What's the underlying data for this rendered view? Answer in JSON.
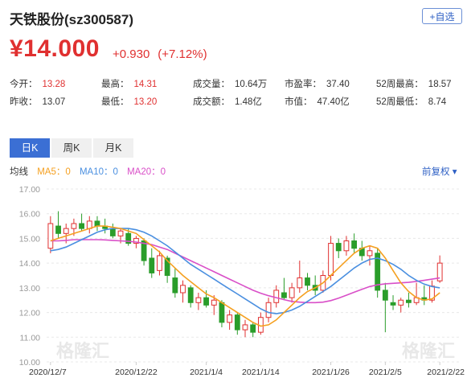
{
  "header": {
    "stock_title": "天铁股份(sz300587)",
    "add_button": "+自选"
  },
  "quote": {
    "price": "¥14.000",
    "change": "+0.930",
    "change_pct": "(+7.12%)"
  },
  "stats": {
    "open_label": "今开：",
    "open": "13.28",
    "high_label": "最高：",
    "high": "14.31",
    "volume_label": "成交量：",
    "volume": "10.64万",
    "pe_label": "市盈率：",
    "pe": "37.40",
    "w52_high_label": "52周最高：",
    "w52_high": "18.57",
    "prev_close_label": "昨收：",
    "prev_close": "13.07",
    "low_label": "最低：",
    "low": "13.20",
    "turnover_label": "成交额：",
    "turnover": "1.48亿",
    "mcap_label": "市值：",
    "mcap": "47.40亿",
    "w52_low_label": "52周最低：",
    "w52_low": "8.74"
  },
  "tabs": [
    "日K",
    "周K",
    "月K"
  ],
  "ma_legend": {
    "label": "均线",
    "ma5": "MA5：0",
    "ma10": "MA10：0",
    "ma20": "MA20：0"
  },
  "adjust_dropdown": "前复权 ▾",
  "watermark": "格隆汇",
  "colors": {
    "up": "#e03030",
    "down": "#2a9d2a",
    "ma5": "#f5a020",
    "ma10": "#4a8fe0",
    "ma20": "#d94fc8",
    "accent": "#3b6fd4"
  },
  "chart_data": {
    "type": "candlestick",
    "y_ticks": [
      "17.00",
      "16.00",
      "15.00",
      "14.00",
      "13.00",
      "12.00",
      "11.00",
      "10.00"
    ],
    "ylim": [
      10,
      17
    ],
    "x_tick_labels": [
      "2020/12/7",
      "2020/12/22",
      "2021/1/4",
      "2021/1/14",
      "2021/1/26",
      "2021/2/5",
      "2021/2/22"
    ],
    "x_tick_index": [
      0,
      11,
      20,
      27,
      36,
      43,
      50
    ],
    "candles": [
      {
        "o": 14.6,
        "h": 15.9,
        "l": 14.4,
        "c": 15.6
      },
      {
        "o": 15.5,
        "h": 16.1,
        "l": 15.0,
        "c": 15.2
      },
      {
        "o": 15.2,
        "h": 15.6,
        "l": 14.8,
        "c": 15.4
      },
      {
        "o": 15.4,
        "h": 15.8,
        "l": 15.1,
        "c": 15.6
      },
      {
        "o": 15.6,
        "h": 16.0,
        "l": 15.3,
        "c": 15.4
      },
      {
        "o": 15.4,
        "h": 15.9,
        "l": 15.2,
        "c": 15.7
      },
      {
        "o": 15.7,
        "h": 15.9,
        "l": 15.3,
        "c": 15.5
      },
      {
        "o": 15.5,
        "h": 15.8,
        "l": 15.2,
        "c": 15.4
      },
      {
        "o": 15.4,
        "h": 15.6,
        "l": 15.0,
        "c": 15.1
      },
      {
        "o": 15.1,
        "h": 15.4,
        "l": 14.8,
        "c": 15.3
      },
      {
        "o": 15.2,
        "h": 15.4,
        "l": 14.7,
        "c": 14.8
      },
      {
        "o": 14.8,
        "h": 15.1,
        "l": 14.6,
        "c": 15.0
      },
      {
        "o": 14.9,
        "h": 15.0,
        "l": 13.9,
        "c": 14.1
      },
      {
        "o": 14.2,
        "h": 14.6,
        "l": 13.4,
        "c": 13.6
      },
      {
        "o": 13.7,
        "h": 14.5,
        "l": 13.5,
        "c": 14.3
      },
      {
        "o": 14.2,
        "h": 14.3,
        "l": 13.2,
        "c": 13.5
      },
      {
        "o": 13.4,
        "h": 13.8,
        "l": 12.6,
        "c": 12.8
      },
      {
        "o": 12.8,
        "h": 13.3,
        "l": 12.4,
        "c": 13.1
      },
      {
        "o": 13.0,
        "h": 13.1,
        "l": 12.2,
        "c": 12.4
      },
      {
        "o": 12.4,
        "h": 12.8,
        "l": 12.1,
        "c": 12.6
      },
      {
        "o": 12.6,
        "h": 12.9,
        "l": 12.2,
        "c": 12.3
      },
      {
        "o": 12.3,
        "h": 12.7,
        "l": 11.9,
        "c": 12.5
      },
      {
        "o": 12.4,
        "h": 12.5,
        "l": 11.4,
        "c": 11.6
      },
      {
        "o": 11.6,
        "h": 12.1,
        "l": 11.3,
        "c": 11.9
      },
      {
        "o": 11.9,
        "h": 12.0,
        "l": 11.1,
        "c": 11.3
      },
      {
        "o": 11.3,
        "h": 11.7,
        "l": 11.0,
        "c": 11.5
      },
      {
        "o": 11.5,
        "h": 11.6,
        "l": 11.0,
        "c": 11.2
      },
      {
        "o": 11.2,
        "h": 12.0,
        "l": 11.1,
        "c": 11.8
      },
      {
        "o": 11.8,
        "h": 12.6,
        "l": 11.6,
        "c": 12.4
      },
      {
        "o": 12.4,
        "h": 13.1,
        "l": 12.2,
        "c": 12.9
      },
      {
        "o": 12.8,
        "h": 13.4,
        "l": 12.5,
        "c": 12.6
      },
      {
        "o": 12.6,
        "h": 13.2,
        "l": 12.4,
        "c": 13.0
      },
      {
        "o": 13.0,
        "h": 14.1,
        "l": 12.8,
        "c": 13.4
      },
      {
        "o": 13.4,
        "h": 13.6,
        "l": 12.9,
        "c": 13.1
      },
      {
        "o": 13.1,
        "h": 13.5,
        "l": 12.7,
        "c": 12.9
      },
      {
        "o": 12.9,
        "h": 13.7,
        "l": 12.8,
        "c": 13.5
      },
      {
        "o": 13.5,
        "h": 15.1,
        "l": 13.3,
        "c": 14.8
      },
      {
        "o": 14.8,
        "h": 15.0,
        "l": 14.2,
        "c": 14.5
      },
      {
        "o": 14.5,
        "h": 15.1,
        "l": 14.3,
        "c": 14.9
      },
      {
        "o": 14.9,
        "h": 15.2,
        "l": 14.4,
        "c": 14.6
      },
      {
        "o": 14.6,
        "h": 14.9,
        "l": 14.1,
        "c": 14.3
      },
      {
        "o": 14.3,
        "h": 14.7,
        "l": 13.9,
        "c": 14.5
      },
      {
        "o": 14.4,
        "h": 14.6,
        "l": 12.6,
        "c": 12.9
      },
      {
        "o": 12.9,
        "h": 13.2,
        "l": 11.2,
        "c": 12.5
      },
      {
        "o": 12.4,
        "h": 12.7,
        "l": 12.1,
        "c": 12.3
      },
      {
        "o": 12.3,
        "h": 12.6,
        "l": 12.0,
        "c": 12.5
      },
      {
        "o": 12.5,
        "h": 12.8,
        "l": 12.2,
        "c": 12.4
      },
      {
        "o": 12.4,
        "h": 13.2,
        "l": 12.3,
        "c": 12.6
      },
      {
        "o": 12.6,
        "h": 13.1,
        "l": 12.3,
        "c": 12.5
      },
      {
        "o": 12.5,
        "h": 13.3,
        "l": 12.4,
        "c": 13.07
      },
      {
        "o": 13.28,
        "h": 14.31,
        "l": 13.2,
        "c": 14.0
      }
    ],
    "ma5": [
      14.9,
      15.0,
      15.1,
      15.2,
      15.3,
      15.4,
      15.5,
      15.5,
      15.45,
      15.4,
      15.3,
      15.2,
      14.95,
      14.7,
      14.45,
      14.1,
      13.8,
      13.5,
      13.25,
      13.0,
      12.75,
      12.6,
      12.4,
      12.2,
      12.0,
      11.8,
      11.6,
      11.45,
      11.5,
      11.7,
      12.0,
      12.3,
      12.6,
      12.85,
      13.0,
      13.2,
      13.5,
      13.8,
      14.1,
      14.4,
      14.6,
      14.7,
      14.6,
      14.2,
      13.7,
      13.2,
      12.85,
      12.6,
      12.5,
      12.55,
      12.8
    ],
    "ma10": [
      14.5,
      14.55,
      14.65,
      14.8,
      14.95,
      15.1,
      15.25,
      15.35,
      15.4,
      15.4,
      15.4,
      15.35,
      15.25,
      15.1,
      14.9,
      14.7,
      14.45,
      14.2,
      13.95,
      13.75,
      13.55,
      13.35,
      13.15,
      12.95,
      12.75,
      12.55,
      12.35,
      12.15,
      12.0,
      11.95,
      12.0,
      12.1,
      12.25,
      12.45,
      12.65,
      12.85,
      13.05,
      13.3,
      13.55,
      13.8,
      14.0,
      14.15,
      14.2,
      14.1,
      13.95,
      13.75,
      13.5,
      13.3,
      13.15,
      13.05,
      13.0
    ],
    "ma20": [
      14.9,
      14.9,
      14.92,
      14.95,
      14.95,
      14.95,
      14.95,
      14.94,
      14.92,
      14.9,
      14.88,
      14.85,
      14.8,
      14.75,
      14.65,
      14.55,
      14.4,
      14.25,
      14.1,
      13.95,
      13.8,
      13.65,
      13.5,
      13.35,
      13.2,
      13.05,
      12.9,
      12.78,
      12.68,
      12.6,
      12.52,
      12.45,
      12.42,
      12.4,
      12.4,
      12.42,
      12.48,
      12.58,
      12.7,
      12.82,
      12.94,
      13.05,
      13.12,
      13.16,
      13.18,
      13.2,
      13.22,
      13.26,
      13.3,
      13.35,
      13.4
    ]
  }
}
